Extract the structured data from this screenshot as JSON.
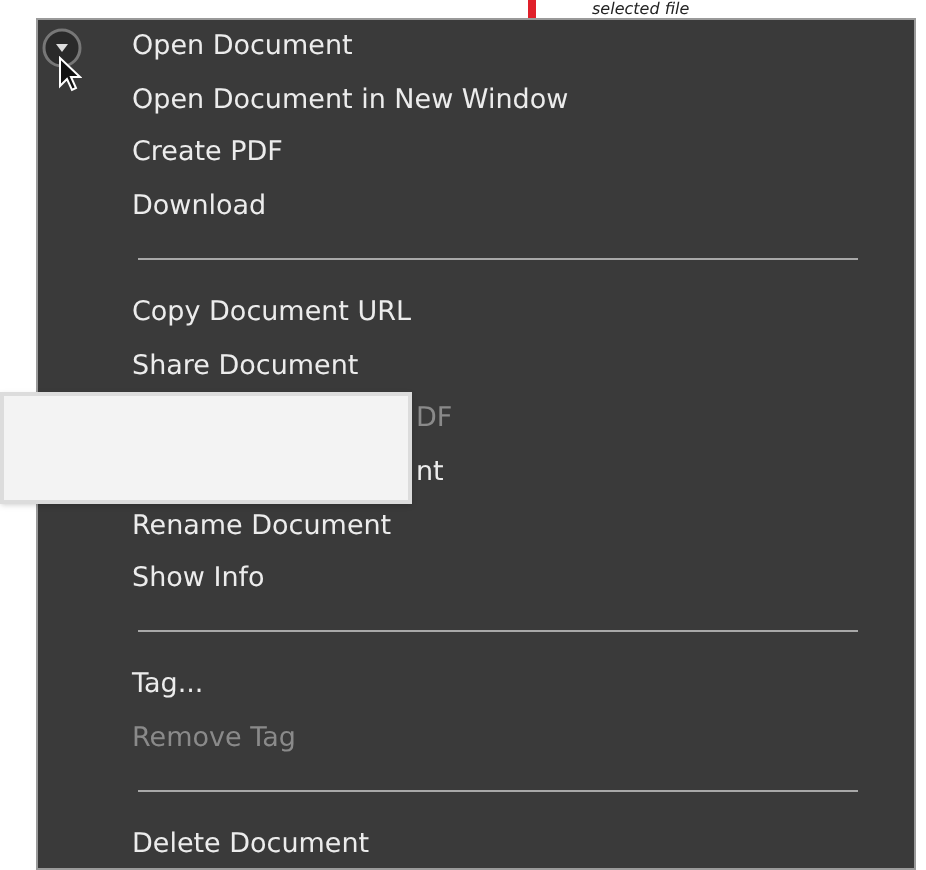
{
  "annotation": {
    "text": "selected file"
  },
  "menu": {
    "items": [
      {
        "kind": "item",
        "label": "Open Document",
        "disabled": false
      },
      {
        "kind": "item",
        "label": "Open Document in New Window",
        "disabled": false
      },
      {
        "kind": "item",
        "label": "Create PDF",
        "disabled": false
      },
      {
        "kind": "item",
        "label": "Download",
        "disabled": false
      },
      {
        "kind": "separator"
      },
      {
        "kind": "item",
        "label": "Copy Document URL",
        "disabled": false
      },
      {
        "kind": "item",
        "label": "Share Document",
        "disabled": false
      },
      {
        "kind": "partial",
        "label": "DF",
        "disabled": true
      },
      {
        "kind": "partial",
        "label": "nt",
        "disabled": false
      },
      {
        "kind": "item",
        "label": "Rename Document",
        "disabled": false
      },
      {
        "kind": "item",
        "label": "Show Info",
        "disabled": false
      },
      {
        "kind": "separator"
      },
      {
        "kind": "item",
        "label": "Tag...",
        "disabled": false
      },
      {
        "kind": "item",
        "label": "Remove Tag",
        "disabled": true
      },
      {
        "kind": "separator"
      },
      {
        "kind": "item",
        "label": "Delete Document",
        "disabled": false
      }
    ]
  }
}
